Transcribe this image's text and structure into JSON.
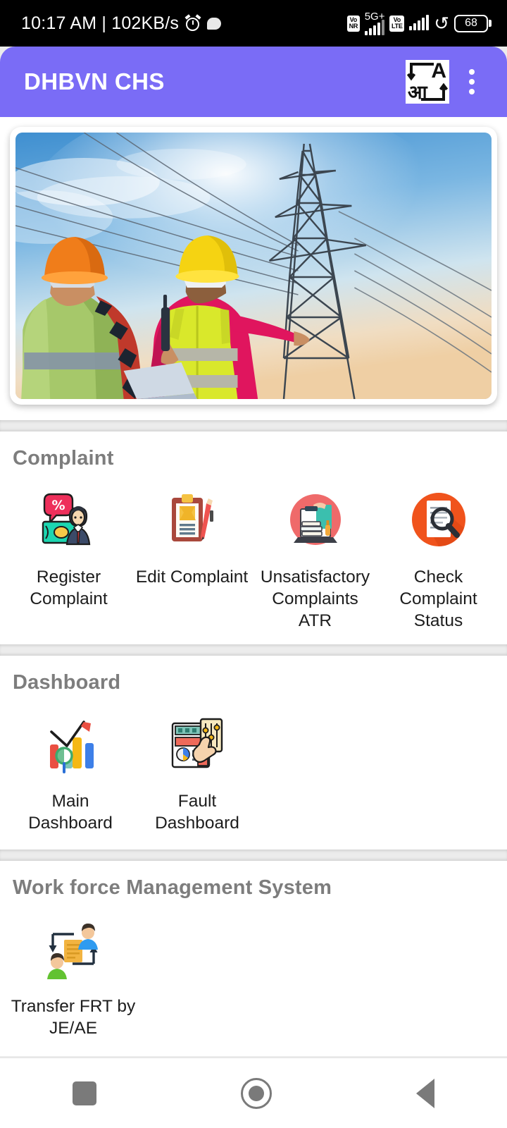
{
  "statusbar": {
    "time_and_speed": "10:17 AM | 102KB/s",
    "alarm_icon": "alarm-clock-icon",
    "chat_icon": "chat-bubble-icon",
    "vonr_badge_line1": "Vo",
    "vonr_badge_line2": "NR",
    "network_label": "5G+",
    "data_arrows": "⇵",
    "volte_badge_line1": "Vo",
    "volte_badge_line2": "LTE",
    "loop_icon": "data-saver-loop-icon",
    "battery_level": "68"
  },
  "appbar": {
    "title": "DHBVN CHS",
    "translate_icon_latin": "A",
    "translate_icon_devanagari": "आ",
    "translate_icon_name": "translate-language-icon",
    "overflow_menu_name": "overflow-menu-icon",
    "background_color": "#7a6cf6",
    "title_color": "#ffffff"
  },
  "banner": {
    "alt": "Two electrical lineworkers in high-visibility vests and hard hats looking up at a high-voltage transmission tower",
    "icon_name": "hero-banner-image"
  },
  "sections": [
    {
      "title": "Complaint",
      "items": [
        {
          "label": "Register Complaint",
          "icon": "register-complaint-icon"
        },
        {
          "label": "Edit Complaint",
          "icon": "edit-complaint-clipboard-icon"
        },
        {
          "label": "Unsatisfactory Complaints ATR",
          "icon": "unsatisfactory-complaints-atr-icon"
        },
        {
          "label": "Check Complaint Status",
          "icon": "check-complaint-status-icon"
        }
      ]
    },
    {
      "title": "Dashboard",
      "items": [
        {
          "label": "Main Dashboard",
          "icon": "main-dashboard-chart-icon"
        },
        {
          "label": "Fault Dashboard",
          "icon": "fault-dashboard-panel-icon"
        }
      ]
    },
    {
      "title": "Work force Management System",
      "items": [
        {
          "label": "Transfer FRT by JE/AE",
          "icon": "transfer-frt-people-icon"
        }
      ]
    }
  ],
  "navbar": {
    "recents": "recents-square-button",
    "home": "home-circle-button",
    "back": "back-triangle-button"
  },
  "colors": {
    "accent_purple": "#7a6cf6",
    "section_title_gray": "#7d7d7d",
    "label_black": "#1d1d1d",
    "page_gap_gray": "#ececec"
  }
}
